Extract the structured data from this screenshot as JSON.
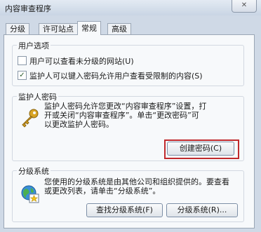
{
  "window": {
    "title": "内容审查程序",
    "close_glyph": "✕"
  },
  "tabs": [
    {
      "label": "分级"
    },
    {
      "label": "许可站点"
    },
    {
      "label": "常规"
    },
    {
      "label": "高级"
    }
  ],
  "user_options": {
    "title": "用户选项",
    "option1": {
      "label": "用户可以查看未分级的网站(U)",
      "checked": false
    },
    "option2": {
      "label": "监护人可以键入密码允许用户查看受限制的内容(S)",
      "checked": true
    }
  },
  "supervisor_password": {
    "title": "监护人密码",
    "icon": "key-icon",
    "desc_lines": [
      "监护人密码允许您更改“内容审查程序”设置，打",
      "开或关闭“内容审查程序”。单击“更改密码”可",
      "以更改监护人密码。"
    ],
    "create_button": "创建密码(C)",
    "highlight_color": "#c0292c"
  },
  "rating_systems": {
    "title": "分级系统",
    "icon": "rating-globe-icon",
    "desc_lines": [
      "您使用的分级系统是由其他公司和组织提供的。要查看",
      "或更改列表，请单击“分级系统”。"
    ],
    "find_button": "查找分级系统(F)",
    "systems_button": "分级系统(R)..."
  }
}
